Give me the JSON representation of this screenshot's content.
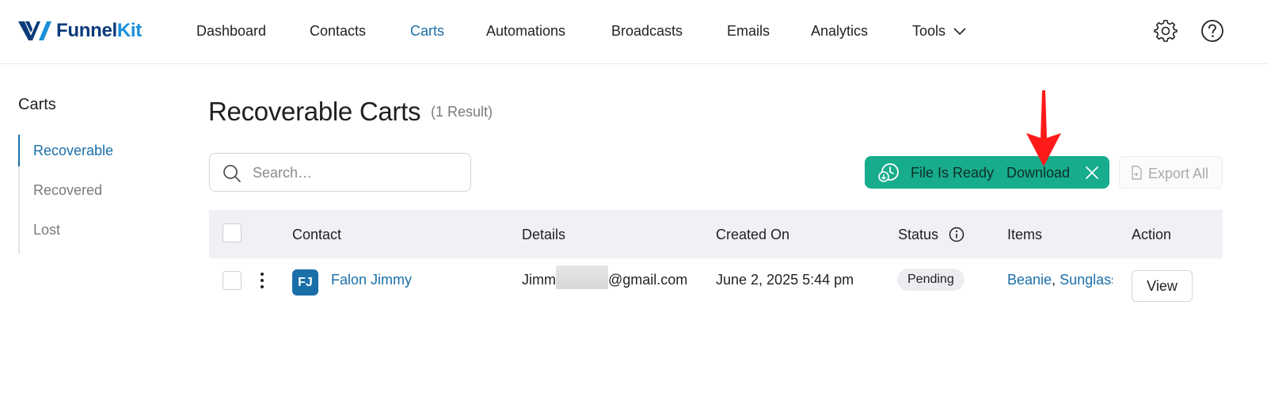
{
  "brand": {
    "name_part1": "Funnel",
    "name_part2": "Kit"
  },
  "nav": {
    "items": [
      "Dashboard",
      "Contacts",
      "Carts",
      "Automations",
      "Broadcasts",
      "Emails",
      "Analytics",
      "Tools"
    ],
    "active": "Carts"
  },
  "sidebar": {
    "title": "Carts",
    "items": [
      "Recoverable",
      "Recovered",
      "Lost"
    ],
    "active": "Recoverable"
  },
  "page": {
    "title": "Recoverable Carts",
    "result_count": "(1 Result)"
  },
  "search": {
    "placeholder": "Search…",
    "value": ""
  },
  "notice": {
    "text": "File Is Ready",
    "link": "Download"
  },
  "export_button": "Export All",
  "table": {
    "headers": {
      "contact": "Contact",
      "details": "Details",
      "created_on": "Created On",
      "status": "Status",
      "items": "Items",
      "action": "Action"
    },
    "rows": [
      {
        "avatar_initials": "FJ",
        "contact": "Falon Jimmy",
        "email_prefix": "Jimm",
        "email_suffix": "@gmail.com",
        "created_on": "June 2, 2025 5:44 pm",
        "status": "Pending",
        "items": [
          "Beanie",
          "Sunglasses"
        ],
        "action": "View"
      }
    ]
  },
  "colors": {
    "accent": "#1a6fa8",
    "notice_bg": "#17ac8c",
    "annotation_arrow": "#ff1a1a"
  }
}
